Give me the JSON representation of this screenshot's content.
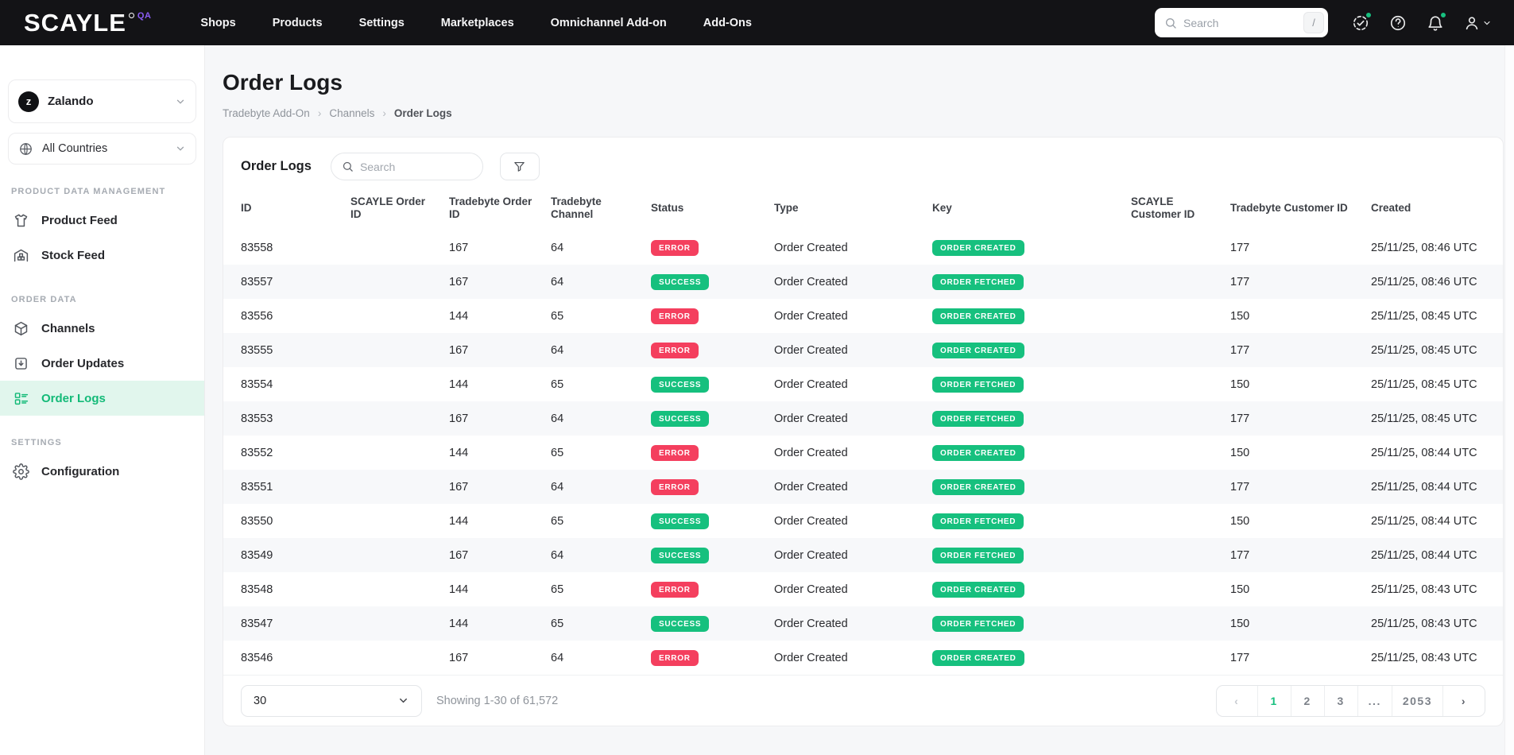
{
  "colors": {
    "topbar_bg": "#131316",
    "accent_green": "#17c07f",
    "status_error_red": "#f43f5e",
    "status_success_green": "#16c07e",
    "brand_purple": "#8b5cf6",
    "active_item_bg": "#e1f6ed"
  },
  "topbar": {
    "logo": "SCAYLE",
    "logo_badge": "QA",
    "nav_items": [
      "Shops",
      "Products",
      "Settings",
      "Marketplaces",
      "Omnichannel Add-on",
      "Add-Ons"
    ],
    "search": {
      "placeholder": "Search",
      "shortcut": "/"
    },
    "icon_names": [
      "status-check-icon",
      "help-icon",
      "notifications-bell-icon",
      "account-icon"
    ]
  },
  "sidebar": {
    "shop_selector": {
      "initial": "z",
      "name": "Zalando"
    },
    "country_selector": {
      "label": "All Countries",
      "icon": "globe-icon"
    },
    "groups": [
      {
        "label": "PRODUCT DATA MANAGEMENT",
        "items": [
          {
            "label": "Product Feed",
            "icon": "tshirt",
            "active": false
          },
          {
            "label": "Stock Feed",
            "icon": "warehouse",
            "active": false
          }
        ]
      },
      {
        "label": "ORDER DATA",
        "items": [
          {
            "label": "Channels",
            "icon": "package",
            "active": false
          },
          {
            "label": "Order Updates",
            "icon": "inbox-down",
            "active": false
          },
          {
            "label": "Order Logs",
            "icon": "list-board",
            "active": true
          }
        ]
      },
      {
        "label": "SETTINGS",
        "items": [
          {
            "label": "Configuration",
            "icon": "gear",
            "active": false
          }
        ]
      }
    ]
  },
  "page": {
    "title": "Order Logs",
    "breadcrumb": [
      "Tradebyte Add-On",
      "Channels",
      "Order Logs"
    ]
  },
  "table_card": {
    "title": "Order Logs",
    "search_placeholder": "Search",
    "columns": [
      {
        "label": "ID",
        "key": "id"
      },
      {
        "label": "SCAYLE Order ID",
        "key": "scayle_order_id"
      },
      {
        "label": "Tradebyte Order ID",
        "key": "tradebyte_order_id"
      },
      {
        "label": "Tradebyte Channel",
        "key": "tradebyte_channel"
      },
      {
        "label": "Status",
        "key": "status"
      },
      {
        "label": "Type",
        "key": "type"
      },
      {
        "label": "Key",
        "key": "key"
      },
      {
        "label": "SCAYLE Customer ID",
        "key": "scayle_customer_id"
      },
      {
        "label": "Tradebyte Customer ID",
        "key": "tradebyte_customer_id"
      },
      {
        "label": "Created",
        "key": "created"
      }
    ],
    "rows": [
      {
        "id": "83558",
        "scayle_order_id": "",
        "tradebyte_order_id": "167",
        "tradebyte_channel": "64",
        "status": "ERROR",
        "type": "Order Created",
        "key": "ORDER CREATED",
        "scayle_customer_id": "",
        "tradebyte_customer_id": "177",
        "created": "25/11/25, 08:46 UTC"
      },
      {
        "id": "83557",
        "scayle_order_id": "",
        "tradebyte_order_id": "167",
        "tradebyte_channel": "64",
        "status": "SUCCESS",
        "type": "Order Created",
        "key": "ORDER FETCHED",
        "scayle_customer_id": "",
        "tradebyte_customer_id": "177",
        "created": "25/11/25, 08:46 UTC"
      },
      {
        "id": "83556",
        "scayle_order_id": "",
        "tradebyte_order_id": "144",
        "tradebyte_channel": "65",
        "status": "ERROR",
        "type": "Order Created",
        "key": "ORDER CREATED",
        "scayle_customer_id": "",
        "tradebyte_customer_id": "150",
        "created": "25/11/25, 08:45 UTC"
      },
      {
        "id": "83555",
        "scayle_order_id": "",
        "tradebyte_order_id": "167",
        "tradebyte_channel": "64",
        "status": "ERROR",
        "type": "Order Created",
        "key": "ORDER CREATED",
        "scayle_customer_id": "",
        "tradebyte_customer_id": "177",
        "created": "25/11/25, 08:45 UTC"
      },
      {
        "id": "83554",
        "scayle_order_id": "",
        "tradebyte_order_id": "144",
        "tradebyte_channel": "65",
        "status": "SUCCESS",
        "type": "Order Created",
        "key": "ORDER FETCHED",
        "scayle_customer_id": "",
        "tradebyte_customer_id": "150",
        "created": "25/11/25, 08:45 UTC"
      },
      {
        "id": "83553",
        "scayle_order_id": "",
        "tradebyte_order_id": "167",
        "tradebyte_channel": "64",
        "status": "SUCCESS",
        "type": "Order Created",
        "key": "ORDER FETCHED",
        "scayle_customer_id": "",
        "tradebyte_customer_id": "177",
        "created": "25/11/25, 08:45 UTC"
      },
      {
        "id": "83552",
        "scayle_order_id": "",
        "tradebyte_order_id": "144",
        "tradebyte_channel": "65",
        "status": "ERROR",
        "type": "Order Created",
        "key": "ORDER CREATED",
        "scayle_customer_id": "",
        "tradebyte_customer_id": "150",
        "created": "25/11/25, 08:44 UTC"
      },
      {
        "id": "83551",
        "scayle_order_id": "",
        "tradebyte_order_id": "167",
        "tradebyte_channel": "64",
        "status": "ERROR",
        "type": "Order Created",
        "key": "ORDER CREATED",
        "scayle_customer_id": "",
        "tradebyte_customer_id": "177",
        "created": "25/11/25, 08:44 UTC"
      },
      {
        "id": "83550",
        "scayle_order_id": "",
        "tradebyte_order_id": "144",
        "tradebyte_channel": "65",
        "status": "SUCCESS",
        "type": "Order Created",
        "key": "ORDER FETCHED",
        "scayle_customer_id": "",
        "tradebyte_customer_id": "150",
        "created": "25/11/25, 08:44 UTC"
      },
      {
        "id": "83549",
        "scayle_order_id": "",
        "tradebyte_order_id": "167",
        "tradebyte_channel": "64",
        "status": "SUCCESS",
        "type": "Order Created",
        "key": "ORDER FETCHED",
        "scayle_customer_id": "",
        "tradebyte_customer_id": "177",
        "created": "25/11/25, 08:44 UTC"
      },
      {
        "id": "83548",
        "scayle_order_id": "",
        "tradebyte_order_id": "144",
        "tradebyte_channel": "65",
        "status": "ERROR",
        "type": "Order Created",
        "key": "ORDER CREATED",
        "scayle_customer_id": "",
        "tradebyte_customer_id": "150",
        "created": "25/11/25, 08:43 UTC"
      },
      {
        "id": "83547",
        "scayle_order_id": "",
        "tradebyte_order_id": "144",
        "tradebyte_channel": "65",
        "status": "SUCCESS",
        "type": "Order Created",
        "key": "ORDER FETCHED",
        "scayle_customer_id": "",
        "tradebyte_customer_id": "150",
        "created": "25/11/25, 08:43 UTC"
      },
      {
        "id": "83546",
        "scayle_order_id": "",
        "tradebyte_order_id": "167",
        "tradebyte_channel": "64",
        "status": "ERROR",
        "type": "Order Created",
        "key": "ORDER CREATED",
        "scayle_customer_id": "",
        "tradebyte_customer_id": "177",
        "created": "25/11/25, 08:43 UTC"
      }
    ],
    "footer": {
      "per_page": "30",
      "showing": "Showing 1-30 of 61,572",
      "pagination": {
        "prev": "‹",
        "next": "›",
        "pages": [
          "1",
          "2",
          "3",
          "...",
          "2053"
        ],
        "active_page": "1"
      }
    }
  }
}
